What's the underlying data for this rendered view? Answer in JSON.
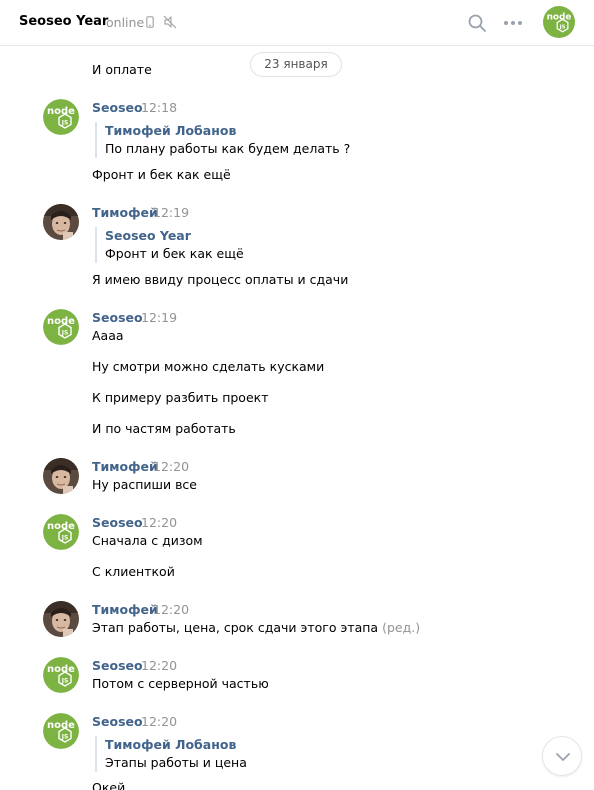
{
  "header": {
    "title": "Seoseo Year",
    "status": "online",
    "icons": [
      "phone-icon",
      "mute-icon",
      "search-icon",
      "more-icon"
    ]
  },
  "date_separator": "23 января",
  "colors": {
    "link": "#42648b",
    "muted": "#939393",
    "node_green": "#7cb342"
  },
  "messages": [
    {
      "lines": [
        "И оплате"
      ]
    },
    {
      "author": "Seoseo",
      "time": "12:18",
      "avatar": "node-js-avatar",
      "quote": {
        "author": "Тимофей Лобанов",
        "text": "По плану работы как будем делать ?"
      },
      "lines": [
        "Фронт и бек как ещё"
      ]
    },
    {
      "author": "Тимофей",
      "time": "12:19",
      "avatar": "user-photo-avatar",
      "quote": {
        "author": "Seoseo Year",
        "text": "Фронт и бек как ещё"
      },
      "lines": [
        "Я имею ввиду процесс оплаты и сдачи"
      ]
    },
    {
      "author": "Seoseo",
      "time": "12:19",
      "avatar": "node-js-avatar",
      "lines": [
        "Аааа",
        "Ну смотри можно сделать кусками",
        "К примеру разбить проект",
        "И по частям работать"
      ]
    },
    {
      "author": "Тимофей",
      "time": "12:20",
      "avatar": "user-photo-avatar",
      "lines": [
        "Ну распиши все"
      ]
    },
    {
      "author": "Seoseo",
      "time": "12:20",
      "avatar": "node-js-avatar",
      "lines": [
        "Сначала с дизом",
        "С клиенткой"
      ]
    },
    {
      "author": "Тимофей",
      "time": "12:20",
      "avatar": "user-photo-avatar",
      "lines": [
        "Этап работы, цена, срок сдачи этого этапа"
      ],
      "edited": "(ред.)"
    },
    {
      "author": "Seoseo",
      "time": "12:20",
      "avatar": "node-js-avatar",
      "lines": [
        "Потом с серверной частью"
      ]
    },
    {
      "author": "Seoseo",
      "time": "12:20",
      "avatar": "node-js-avatar",
      "quote": {
        "author": "Тимофей Лобанов",
        "text": "Этапы работы и цена"
      },
      "lines": [
        "Окей"
      ]
    }
  ]
}
